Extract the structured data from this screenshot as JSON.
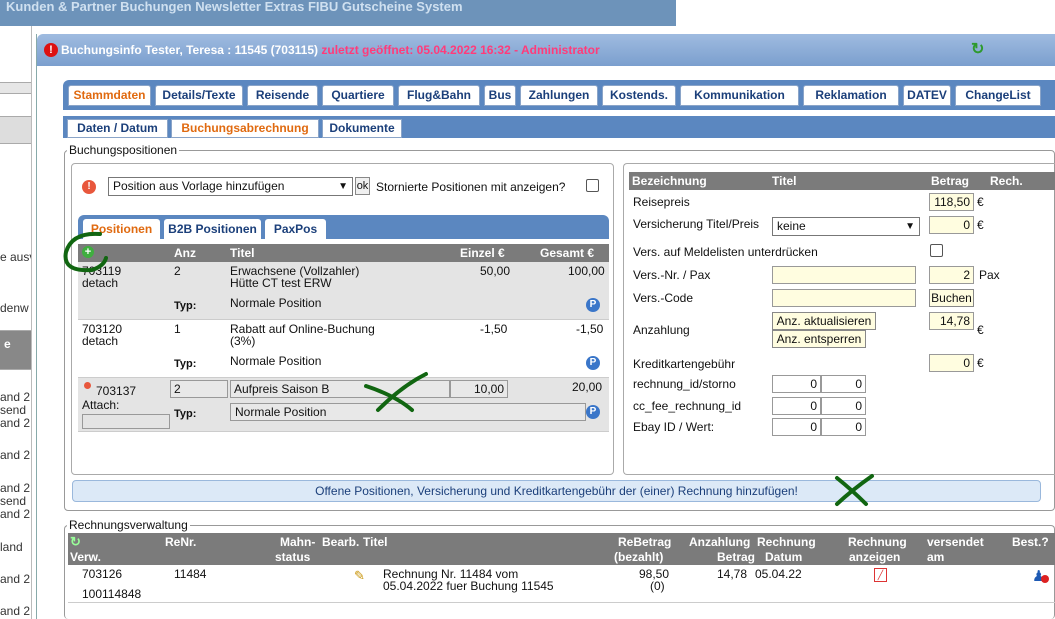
{
  "top_menu": "Kunden & Partner   Buchungen   Newsletter   Extras   FIBU   Gutscheine   System",
  "left_col": [
    "e ausv",
    "denw",
    "e",
    "and 2",
    "send",
    "and 2",
    "and 2",
    "and 2",
    "send",
    "and 2",
    "land",
    "and 2",
    "and 2"
  ],
  "window": {
    "title_main": "Buchungsinfo Tester, Teresa : 11545 (703115)",
    "title_last": "zuletzt geöffnet: 05.04.2022 16:32 - Administrator"
  },
  "tabs": [
    "Stammdaten",
    "Details/Texte",
    "Reisende",
    "Quartiere",
    "Flug&Bahn",
    "Bus",
    "Zahlungen",
    "Kostends.",
    "Kommunikation",
    "Reklamation",
    "DATEV",
    "ChangeList"
  ],
  "subtabs": [
    "Daten / Datum",
    "Buchungsabrechnung",
    "Dokumente"
  ],
  "positions": {
    "legend": "Buchungspositionen",
    "template_select": "Position aus Vorlage hinzufügen",
    "ok": "ok",
    "show_cancelled": "Stornierte Positionen mit anzeigen?",
    "tabs": [
      "Positionen",
      "B2B Positionen",
      "PaxPos"
    ],
    "head": {
      "anz": "Anz",
      "titel": "Titel",
      "einzel": "Einzel €",
      "gesamt": "Gesamt €"
    },
    "typ_label": "Typ:",
    "rows": [
      {
        "id": "703119",
        "link": "detach",
        "anz": "2",
        "titel": "Erwachsene (Vollzahler)",
        "titel2": "Hütte CT test ERW",
        "einzel": "50,00",
        "gesamt": "100,00",
        "typ": "Normale Position"
      },
      {
        "id": "703120",
        "link": "detach",
        "anz": "1",
        "titel": "Rabatt auf Online-Buchung",
        "titel2": "(3%)",
        "einzel": "-1,50",
        "gesamt": "-1,50",
        "typ": "Normale Position"
      },
      {
        "id": "703137",
        "link": "Attach:",
        "anz": "2",
        "titel": "Aufpreis Saison B",
        "titel2": "",
        "einzel": "10,00",
        "gesamt": "20,00",
        "typ": "Normale Position"
      }
    ]
  },
  "summary": {
    "head": {
      "bez": "Bezeichnung",
      "titel": "Titel",
      "betrag": "Betrag",
      "rech": "Rech."
    },
    "reisepreis_label": "Reisepreis",
    "reisepreis": "118,50",
    "vers_label": "Versicherung Titel/Preis",
    "vers_select": "keine",
    "vers_value": "0",
    "melde_label": "Vers. auf Meldelisten unterdrücken",
    "versnr_label": "Vers.-Nr. / Pax",
    "pax_value": "2",
    "pax_unit": "Pax",
    "verscode_label": "Vers.-Code",
    "buchen": "Buchen",
    "anz_label": "Anzahlung",
    "anz_update": "Anz. aktualisieren",
    "anz_unlock": "Anz. entsperren",
    "anz_value": "14,78",
    "kk_label": "Kreditkartengebühr",
    "kk_value": "0",
    "rid_label": "rechnung_id/storno",
    "rid1": "0",
    "rid2": "0",
    "cc_label": "cc_fee_rechnung_id",
    "cc1": "0",
    "cc2": "0",
    "ebay_label": "Ebay ID / Wert:",
    "eb1": "0",
    "eb2": "0",
    "euro": "€"
  },
  "open_positions": "Offene Positionen, Versicherung und Kreditkartengebühr der (einer) Rechnung hinzufügen!",
  "rechnung": {
    "legend": "Rechnungsverwaltung",
    "head": {
      "verw": "Verw.",
      "renr": "ReNr.",
      "mahn": "Mahn-",
      "mahn2": "status",
      "bearb": "Bearb.",
      "titel": "Titel",
      "rebetrag": "ReBetrag",
      "rebetrag2": "(bezahlt)",
      "anz": "Anzahlung",
      "anz2": "Betrag",
      "rdat": "Rechnung",
      "rdat2": "Datum",
      "ranz": "Rechnung",
      "ranz2": "anzeigen",
      "vers": "versendet",
      "vers2": "am",
      "best": "Best.?"
    },
    "row": {
      "verw": "703126",
      "verw2": "100114848",
      "renr": "11484",
      "titel": "Rechnung Nr. 11484 vom",
      "titel2": "05.04.2022 fuer Buchung 11545",
      "betrag": "98,50",
      "bezahlt": "(0)",
      "anz": "14,78",
      "datum": "05.04.22"
    }
  },
  "colors": {
    "accent": "#e06a10",
    "tabbar": "#5b87c0",
    "annotation": "#116611"
  }
}
